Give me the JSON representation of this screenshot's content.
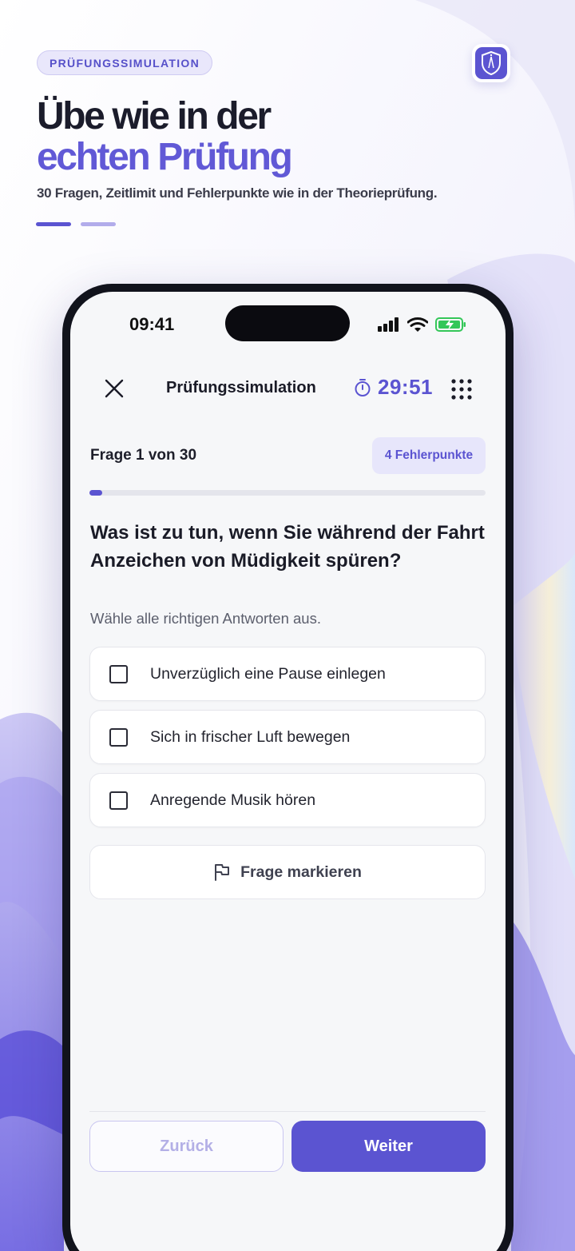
{
  "promo": {
    "badge": "PRÜFUNGSSIMULATION",
    "headline_line1": "Übe wie in der",
    "headline_line2": "echten Prüfung",
    "subline": "30 Fragen, Zeitlimit und Fehlerpunkte wie in der Theorieprüfung.",
    "page_indicator": {
      "count": 2,
      "active_index": 0
    }
  },
  "colors": {
    "accent": "#5b54d1",
    "accent_light": "#e7e6fb",
    "headline_dark": "#1b1c2b",
    "headline_accent": "#6159d6"
  },
  "status_bar": {
    "time": "09:41",
    "icons": [
      "cellular-signal-icon",
      "wifi-icon",
      "battery-charging-icon"
    ]
  },
  "nav": {
    "close_icon": "close-icon",
    "title": "Prüfungssimulation",
    "timer_icon": "stopwatch-icon",
    "timer": "29:51",
    "overview_icon": "grid-dots-icon"
  },
  "quiz": {
    "question_counter": "Frage 1 von 30",
    "error_points": "4 Fehlerpunkte",
    "progress_fraction": 0.033,
    "question": "Was ist zu tun, wenn Sie während der Fahrt Anzeichen von Müdigkeit spüren?",
    "hint": "Wähle alle richtigen Antworten aus.",
    "answers": [
      {
        "text": "Unverzüglich eine Pause einlegen",
        "checked": false
      },
      {
        "text": "Sich in frischer Luft bewegen",
        "checked": false
      },
      {
        "text": "Anregende Musik hören",
        "checked": false
      }
    ],
    "flag_label": "Frage markieren"
  },
  "footer": {
    "back_label": "Zurück",
    "next_label": "Weiter"
  }
}
